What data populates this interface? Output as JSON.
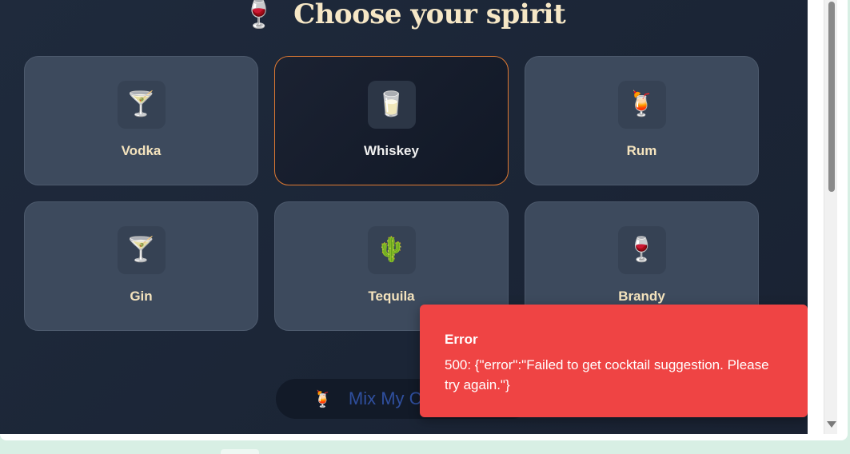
{
  "header": {
    "icon": "wine-glass-icon",
    "icon_glyph": "🍷",
    "title": "Choose your spirit"
  },
  "spirits": [
    {
      "name": "Vodka",
      "icon": "cocktail-glass-icon",
      "glyph": "🍸",
      "selected": false
    },
    {
      "name": "Whiskey",
      "icon": "tumbler-glass-icon",
      "glyph": "🥛",
      "selected": true
    },
    {
      "name": "Rum",
      "icon": "tropical-drink-icon",
      "glyph": "🍹",
      "selected": false
    },
    {
      "name": "Gin",
      "icon": "cocktail-glass-icon",
      "glyph": "🍸",
      "selected": false
    },
    {
      "name": "Tequila",
      "icon": "cactus-icon",
      "glyph": "🌵",
      "selected": false
    },
    {
      "name": "Brandy",
      "icon": "wine-glass-icon",
      "glyph": "🍷",
      "selected": false
    }
  ],
  "mix_button": {
    "icon": "tropical-drink-icon",
    "glyph": "🍹",
    "label": "Mix My C"
  },
  "toast": {
    "title": "Error",
    "message": "500: {\"error\":\"Failed to get cocktail suggestion. Please try again.\"}"
  },
  "colors": {
    "accent": "#e07a32",
    "error": "#ef4444",
    "title": "#f6e7c6"
  }
}
